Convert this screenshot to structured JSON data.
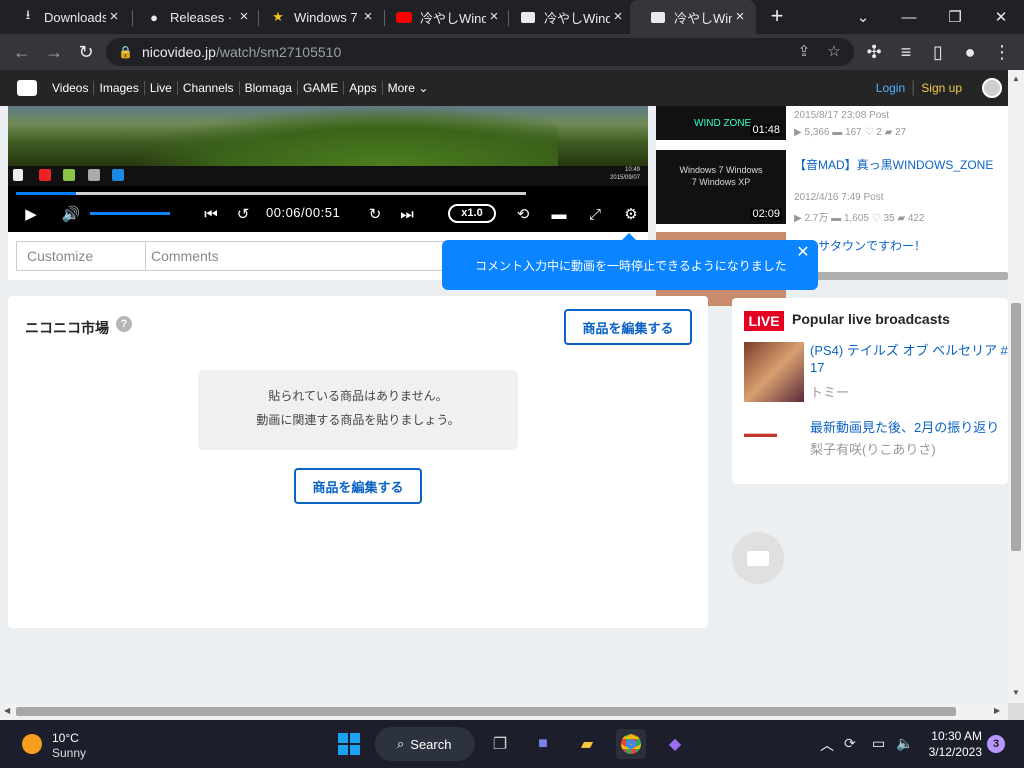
{
  "browser": {
    "tabs": [
      {
        "label": "Downloads",
        "icon": "download-icon"
      },
      {
        "label": "Releases · g",
        "icon": "github-icon"
      },
      {
        "label": "Windows 7",
        "icon": "star-icon"
      },
      {
        "label": "冷やしWind",
        "icon": "youtube-icon"
      },
      {
        "label": "冷やしWind",
        "icon": "niconico-icon"
      },
      {
        "label": "冷やしWind",
        "icon": "niconico-icon",
        "active": true
      }
    ],
    "url_host": "nicovideo.jp",
    "url_path": "/watch/sm27105510"
  },
  "nico_header": {
    "nav": [
      "Videos",
      "Images",
      "Live",
      "Channels",
      "Blomaga",
      "GAME",
      "Apps",
      "More"
    ],
    "login": "Login",
    "signup": "Sign up"
  },
  "player": {
    "current_time": "00:06",
    "duration": "00:51",
    "time_display": "00:06/00:51",
    "progress_fraction": 0.118,
    "buffer_fraction": 1.0,
    "volume_fraction": 1.0,
    "speed": "x1.0",
    "in_video_clock_time": "10:49",
    "in_video_clock_date": "2015/09/07"
  },
  "comment_bar": {
    "customize_label": "Customize",
    "comment_placeholder": "Comments"
  },
  "tooltip": {
    "text": "コメント入力中に動画を一時停止できるようになりました"
  },
  "related": [
    {
      "thumb_text": "WIND ZONE",
      "duration": "01:48",
      "title": "",
      "posted": "2015/8/17 23:08 Post",
      "stats": [
        "5,366",
        "167",
        "2",
        "27"
      ]
    },
    {
      "thumb_text": "Windows 7 Windows 7 Windows XP",
      "duration": "02:09",
      "title": "【音MAD】真っ黒WINDOWS_ZONE",
      "posted": "2012/4/16 7:49 Post",
      "stats": [
        "2.7万",
        "1,605",
        "35",
        "422"
      ]
    },
    {
      "thumb_text": "",
      "duration": "",
      "title": "ックサタウンですわー！",
      "posted": "",
      "stats": []
    }
  ],
  "market": {
    "title": "ニコニコ市場",
    "edit_label": "商品を編集する",
    "empty_line1": "貼られている商品はありません。",
    "empty_line2": "動画に関連する商品を貼りましょう。"
  },
  "live": {
    "badge": "LIVE",
    "title": "Popular live broadcasts",
    "items": [
      {
        "title_line1": "(PS4) テイルズ オブ ベルセリア #",
        "title_line2": "17",
        "user": "トミー"
      },
      {
        "title_line1": "最新動画見た後、2月の振り返り",
        "title_line2": "",
        "user": "梨子有咲(りこありさ)"
      }
    ]
  },
  "taskbar": {
    "temp": "10°C",
    "weather": "Sunny",
    "search": "Search",
    "time": "10:30 AM",
    "date": "3/12/2023",
    "notifications": "3"
  }
}
